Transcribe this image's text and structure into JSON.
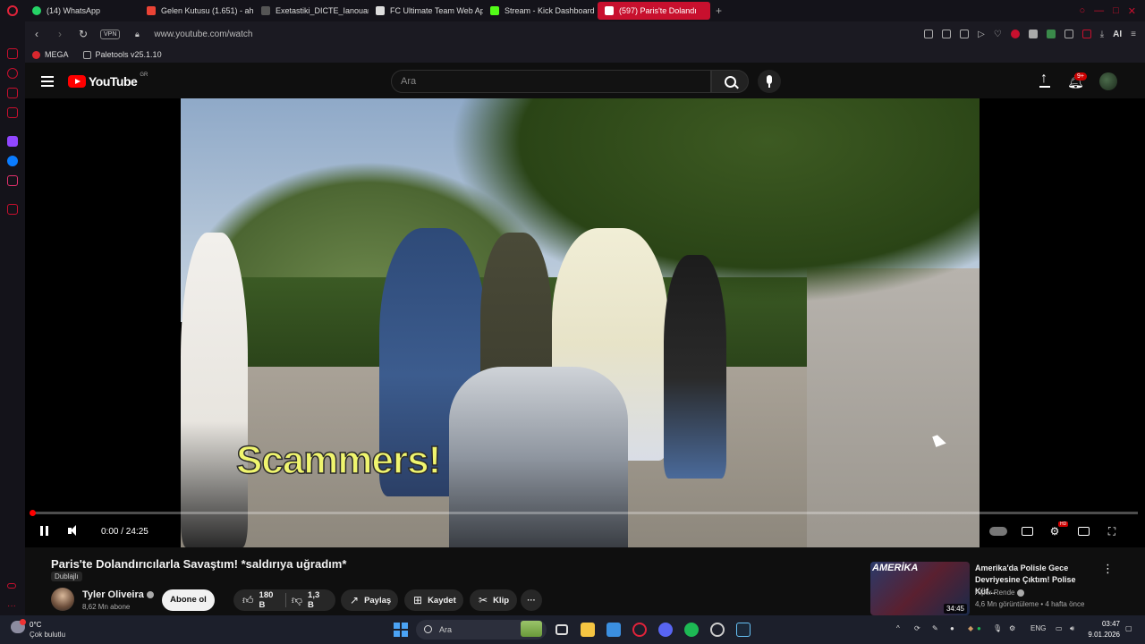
{
  "browser": {
    "tabs": [
      {
        "label": "(14) WhatsApp",
        "icon": "whatsapp-icon",
        "color": "#25d366"
      },
      {
        "label": "Gelen Kutusu (1.651) - ahm",
        "icon": "gmail-icon",
        "color": "#ea4335"
      },
      {
        "label": "Exetastiki_DICTE_Ianouar",
        "icon": "document-icon",
        "color": "#555555"
      },
      {
        "label": "FC Ultimate Team Web Ap",
        "icon": "fc-icon",
        "color": "#dddddd"
      },
      {
        "label": "Stream - Kick Dashboard",
        "icon": "kick-icon",
        "color": "#53fc18"
      },
      {
        "label": "(597) Paris'te Dolandı",
        "icon": "youtube-icon",
        "color": "#ff0000"
      }
    ],
    "vpn_label": "VPN",
    "url": "www.youtube.com/watch",
    "bookmarks": [
      {
        "label": "MEGA",
        "icon": "mega-icon",
        "color": "#d9272e"
      },
      {
        "label": "Paletools v25.1.10",
        "icon": "page-icon",
        "color": "#888888"
      }
    ],
    "accent": "#c8102e"
  },
  "youtube": {
    "logo_word": "YouTube",
    "region": "GR",
    "search_placeholder": "Ara",
    "notification_count": "9+"
  },
  "player": {
    "overlay_text": "Scammers!",
    "time": "0:00 / 24:25",
    "progress": 0.0,
    "hd_badge": "HD"
  },
  "video": {
    "title": "Paris'te Dolandırıcılarla Savaştım! *saldırıya uğradım*",
    "dubbed": "Dublajlı",
    "channel": "Tyler Oliveira",
    "subscribers": "8,62 Mn abone",
    "subscribe_label": "Abone ol",
    "likes": "180 B",
    "dislikes": "1,3 B",
    "share_label": "Paylaş",
    "save_label": "Kaydet",
    "clip_label": "Klip"
  },
  "recommendation": {
    "thumb_text": "AMERİKA",
    "duration": "34:45",
    "title": "Amerika'da Polisle Gece Devriyesine Çıktım! Polise Küf...",
    "channel": "Alper Rende",
    "meta": "4,6 Mn görüntüleme • 4 hafta önce"
  },
  "taskbar": {
    "temperature": "0°C",
    "weather": "Çok bulutlu",
    "search": "Ara",
    "language": "ENG",
    "time": "03:47",
    "date": "9.01.2026"
  }
}
